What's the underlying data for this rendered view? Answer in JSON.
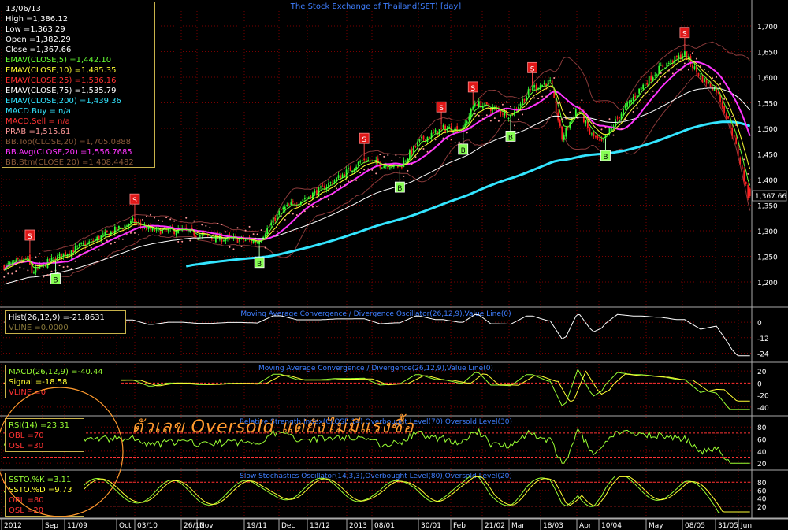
{
  "chart_title": "The Stock Exchange of Thailand(SET) [day]",
  "ohlc": {
    "date": "13/06/13",
    "high": "High =1,386.12",
    "low": "Low =1,363.29",
    "open": "Open =1,382.29",
    "close": "Close =1,367.66"
  },
  "legend": [
    {
      "text": "EMAV(CLOSE,5) =1,442.10",
      "color": "#66ff33"
    },
    {
      "text": "EMAV(CLOSE,10) =1,485.35",
      "color": "#ffff33"
    },
    {
      "text": "EMAV(CLOSE,25) =1,536.16",
      "color": "#ff3333"
    },
    {
      "text": "EMAV(CLOSE,75) =1,535.79",
      "color": "#ffffff"
    },
    {
      "text": "EMAV(CLOSE,200) =1,439.36",
      "color": "#33e5ff"
    },
    {
      "text": "MACD.Buy = n/a",
      "color": "#33e5ff"
    },
    {
      "text": "MACD.Sell = n/a",
      "color": "#ff3333"
    },
    {
      "text": "PRAB =1,515.61",
      "color": "#ff9999"
    },
    {
      "text": "BB.Top(CLOSE,20) =1,705.0888",
      "color": "#8a5a3a"
    },
    {
      "text": "BB.Avg(CLOSE,20) =1,556.7685",
      "color": "#ff33ff"
    },
    {
      "text": "BB.Btm(CLOSE,20) =1,408.4482",
      "color": "#8a5a3a"
    }
  ],
  "colors": {
    "grid": "#7a0000",
    "axis_text": "#ffffff",
    "title_text": "#3f7fff",
    "candle_up": "#33ff33",
    "candle_down": "#ff2222",
    "ema5": "#66ff33",
    "ema10": "#ffff33",
    "ema200": "#33e5ff",
    "ema75": "#ffffff",
    "bb_avg": "#ff33ff",
    "bb_band": "#8a3a3a",
    "sar": "#ff9999",
    "osc_line": "#ffffff",
    "green_line": "#99ff33",
    "yellow_line": "#ffff33",
    "level_line": "#ff3333",
    "annotation": "#ff9a2e"
  },
  "price_axis": {
    "ticks": [
      "1,700",
      "1,650",
      "1,600",
      "1,550",
      "1,500",
      "1,450",
      "1,400",
      "1,350",
      "1,300",
      "1,250",
      "1,200"
    ],
    "last_label": "1,367.66"
  },
  "signals": [
    {
      "type": "S",
      "i": 13
    },
    {
      "type": "B",
      "i": 26
    },
    {
      "type": "S",
      "i": 66
    },
    {
      "type": "B",
      "i": 129
    },
    {
      "type": "S",
      "i": 182
    },
    {
      "type": "B",
      "i": 200
    },
    {
      "type": "S",
      "i": 221
    },
    {
      "type": "B",
      "i": 232
    },
    {
      "type": "S",
      "i": 237
    },
    {
      "type": "B",
      "i": 256
    },
    {
      "type": "S",
      "i": 267
    },
    {
      "type": "B",
      "i": 304
    },
    {
      "type": "S",
      "i": 344
    }
  ],
  "panels": {
    "hist": {
      "title": "Moving Average Convergence / Divergence Oscillator(26,12,9),Value Line(0)",
      "label1": "Hist(26,12,9) =-21.8631",
      "label2": "VLINE =0.0000",
      "ticks": [
        "0",
        "-12",
        "-24"
      ]
    },
    "macd": {
      "title": "Moving Average Convergence / Divergence(26,12,9),Value Line(0)",
      "label1": "MACD(26,12,9) =-40.44",
      "label2": "Signal =-18.58",
      "label3": "VLINE =0",
      "ticks": [
        "20",
        "0",
        "-20",
        "-40"
      ]
    },
    "rsi": {
      "title": "Relative Strength Index(CLOSE,14),Overbought Level(70),Oversold Level(30)",
      "label1": "RSI(14) =23.31",
      "label2": "OBL =70",
      "label3": "OSL =30",
      "ticks": [
        "80",
        "60",
        "40",
        "20"
      ]
    },
    "sto": {
      "title": "Slow Stochastics Oscillator(14,3,3),Overbought Level(80),Oversold Level(20)",
      "label1": "SSTO.%K =3.11",
      "label2": "SSTO.%D =9.73",
      "label3": "OBL =80",
      "label4": "OSL =20",
      "ticks": [
        "80",
        "60",
        "40",
        "20"
      ]
    }
  },
  "date_axis": [
    "2012",
    "Sep",
    "11/09",
    "Oct",
    "03/10",
    "26/10",
    "Nov",
    "19/11",
    "Dec",
    "13/12",
    "2013",
    "08/01",
    "30/01",
    "Feb",
    "21/02",
    "Mar",
    "18/03",
    "Apr",
    "10/04",
    "May",
    "08/05",
    "31/05",
    "Jun"
  ],
  "annotation_text": "ตัวเลข Oversold แต่ยังไม่มีแรงซื้อ",
  "chart_data": {
    "type": "line",
    "title": "The Stock Exchange of Thailand(SET) [day]",
    "ylabel": "",
    "ylim": [
      1150,
      1720
    ],
    "x_labels": [
      "2012",
      "Sep",
      "11/09",
      "Oct",
      "03/10",
      "26/10",
      "Nov",
      "19/11",
      "Dec",
      "13/12",
      "2013",
      "08/01",
      "30/01",
      "Feb",
      "21/02",
      "Mar",
      "18/03",
      "Apr",
      "10/04",
      "May",
      "08/05",
      "31/05",
      "Jun"
    ],
    "close_keypoints": [
      {
        "i": 0,
        "v": 1230
      },
      {
        "i": 12,
        "v": 1245
      },
      {
        "i": 14,
        "v": 1218
      },
      {
        "i": 25,
        "v": 1245
      },
      {
        "i": 50,
        "v": 1290
      },
      {
        "i": 65,
        "v": 1318
      },
      {
        "i": 75,
        "v": 1300
      },
      {
        "i": 90,
        "v": 1300
      },
      {
        "i": 105,
        "v": 1286
      },
      {
        "i": 120,
        "v": 1283
      },
      {
        "i": 128,
        "v": 1278
      },
      {
        "i": 140,
        "v": 1340
      },
      {
        "i": 160,
        "v": 1380
      },
      {
        "i": 175,
        "v": 1420
      },
      {
        "i": 182,
        "v": 1440
      },
      {
        "i": 190,
        "v": 1430
      },
      {
        "i": 200,
        "v": 1425
      },
      {
        "i": 210,
        "v": 1475
      },
      {
        "i": 222,
        "v": 1500
      },
      {
        "i": 232,
        "v": 1500
      },
      {
        "i": 238,
        "v": 1550
      },
      {
        "i": 250,
        "v": 1535
      },
      {
        "i": 256,
        "v": 1525
      },
      {
        "i": 267,
        "v": 1580
      },
      {
        "i": 276,
        "v": 1590
      },
      {
        "i": 282,
        "v": 1480
      },
      {
        "i": 290,
        "v": 1545
      },
      {
        "i": 296,
        "v": 1490
      },
      {
        "i": 302,
        "v": 1470
      },
      {
        "i": 310,
        "v": 1520
      },
      {
        "i": 322,
        "v": 1580
      },
      {
        "i": 332,
        "v": 1620
      },
      {
        "i": 344,
        "v": 1645
      },
      {
        "i": 352,
        "v": 1600
      },
      {
        "i": 360,
        "v": 1575
      },
      {
        "i": 366,
        "v": 1515
      },
      {
        "i": 370,
        "v": 1465
      },
      {
        "i": 376,
        "v": 1368
      }
    ],
    "series": [
      {
        "name": "EMAV(CLOSE,5)"
      },
      {
        "name": "EMAV(CLOSE,10)"
      },
      {
        "name": "EMAV(CLOSE,25)"
      },
      {
        "name": "EMAV(CLOSE,75)"
      },
      {
        "name": "EMAV(CLOSE,200)"
      },
      {
        "name": "BB.Top(CLOSE,20)"
      },
      {
        "name": "BB.Avg(CLOSE,20)"
      },
      {
        "name": "BB.Btm(CLOSE,20)"
      },
      {
        "name": "PRAB"
      }
    ],
    "last_values": {
      "close": 1367.66,
      "high": 1386.12,
      "low": 1363.29,
      "open": 1382.29,
      "ema5": 1442.1,
      "ema10": 1485.35,
      "ema25": 1536.16,
      "ema75": 1535.79,
      "ema200": 1439.36,
      "bb_top": 1705.0888,
      "bb_avg": 1556.7685,
      "bb_btm": 1408.4482,
      "prab": 1515.61,
      "hist": -21.8631,
      "macd": -40.44,
      "signal": -18.58,
      "rsi": 23.31,
      "ssto_k": 3.11,
      "ssto_d": 9.73
    },
    "sub_ranges": {
      "hist": [
        -28,
        8
      ],
      "macd": [
        -48,
        28
      ],
      "rsi": [
        15,
        92
      ],
      "sto": [
        0,
        100
      ]
    }
  }
}
